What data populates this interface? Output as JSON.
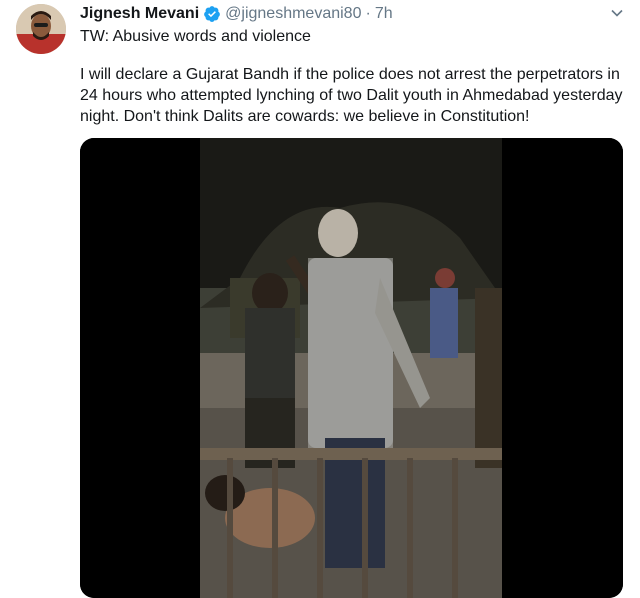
{
  "tweet": {
    "display_name": "Jignesh Mevani",
    "handle": "@jigneshmevani80",
    "separator": "·",
    "time": "7h",
    "content_warning": "TW: Abusive words and violence",
    "text": "I will declare a Gujarat Bandh if the police does not arrest the perpetrators in 24 hours who attempted lynching of two Dalit youth in Ahmedabad yesterday night. Don't think Dalits are cowards: we believe in Constitution!"
  },
  "icons": {
    "verified": "verified-badge-icon",
    "menu": "chevron-down-icon"
  },
  "colors": {
    "verified_blue": "#1da1f2",
    "secondary_text": "#657786",
    "primary_text": "#14171a"
  }
}
